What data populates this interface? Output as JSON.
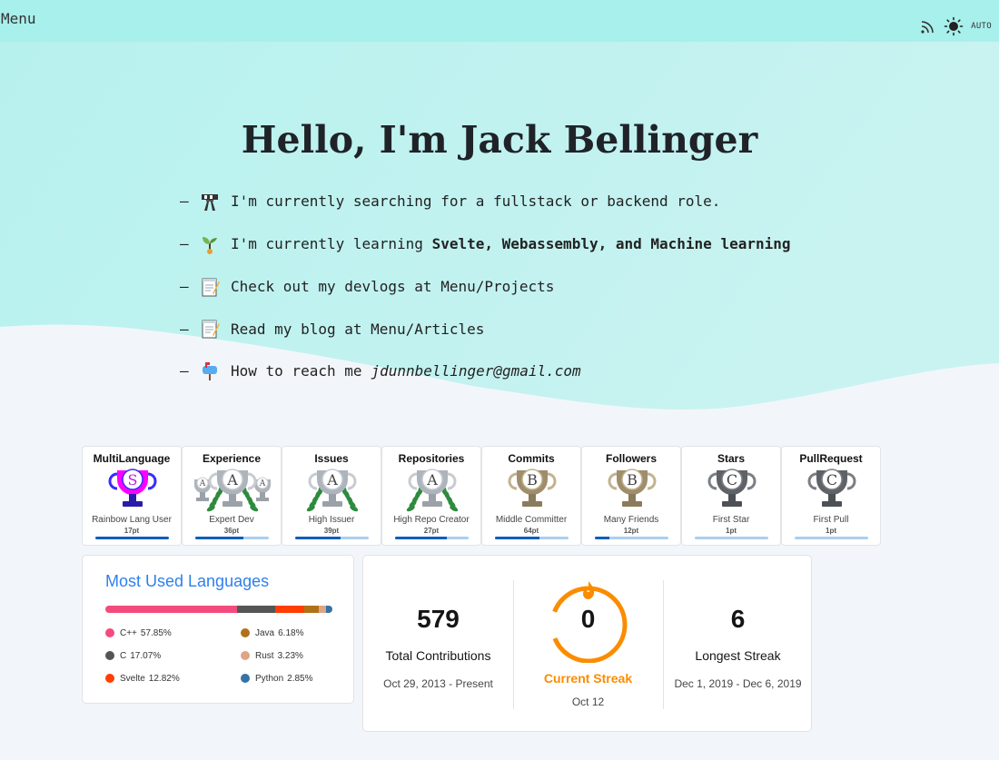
{
  "topbar": {
    "menu_label": "Menu",
    "rss_icon": "rss-icon",
    "theme_icon": "sun-icon",
    "theme_mode": "AUTO"
  },
  "hero": {
    "title": "Hello, I'm Jack Bellinger",
    "lines": [
      {
        "dash": "–",
        "icon": "construction-sign-icon",
        "text": "I'm currently searching for a fullstack or backend role."
      },
      {
        "dash": "–",
        "icon": "seedling-icon",
        "prefix": "I'm currently learning ",
        "bold": "Svelte, Webassembly, and Machine learning"
      },
      {
        "dash": "–",
        "icon": "memo-icon",
        "text": "Check out my devlogs at Menu/Projects"
      },
      {
        "dash": "–",
        "icon": "memo-icon",
        "text": "Read my blog at Menu/Articles"
      },
      {
        "dash": "–",
        "icon": "mailbox-icon",
        "prefix": "How to reach me",
        "email": "jdunnbellinger@gmail.com"
      }
    ]
  },
  "trophies": [
    {
      "category": "MultiLanguage",
      "rank": "S",
      "title": "Rainbow Lang User",
      "points": "17pt",
      "progress": 1.0
    },
    {
      "category": "Experience",
      "rank": "A",
      "title": "Expert Dev",
      "points": "36pt",
      "progress": 0.65
    },
    {
      "category": "Issues",
      "rank": "A",
      "title": "High Issuer",
      "points": "39pt",
      "progress": 0.62
    },
    {
      "category": "Repositories",
      "rank": "A",
      "title": "High Repo Creator",
      "points": "27pt",
      "progress": 0.7
    },
    {
      "category": "Commits",
      "rank": "B",
      "title": "Middle Committer",
      "points": "64pt",
      "progress": 0.6
    },
    {
      "category": "Followers",
      "rank": "B",
      "title": "Many Friends",
      "points": "12pt",
      "progress": 0.2
    },
    {
      "category": "Stars",
      "rank": "C",
      "title": "First Star",
      "points": "1pt",
      "progress": 0.0
    },
    {
      "category": "PullRequest",
      "rank": "C",
      "title": "First Pull",
      "points": "1pt",
      "progress": 0.0
    }
  ],
  "languages": {
    "title": "Most Used Languages",
    "items": [
      {
        "name": "C++",
        "percent": "57.85%",
        "value": 57.85,
        "color": "#f34b7d"
      },
      {
        "name": "C",
        "percent": "17.07%",
        "value": 17.07,
        "color": "#555555"
      },
      {
        "name": "Svelte",
        "percent": "12.82%",
        "value": 12.82,
        "color": "#ff3e00"
      },
      {
        "name": "Java",
        "percent": "6.18%",
        "value": 6.18,
        "color": "#b07219"
      },
      {
        "name": "Rust",
        "percent": "3.23%",
        "value": 3.23,
        "color": "#dea584"
      },
      {
        "name": "Python",
        "percent": "2.85%",
        "value": 2.85,
        "color": "#3572a5"
      }
    ]
  },
  "streak": {
    "total": "579",
    "total_label": "Total Contributions",
    "total_range": "Oct 29, 2013 - Present",
    "current": "0",
    "current_label": "Current Streak",
    "current_date": "Oct 12",
    "longest": "6",
    "longest_label": "Longest Streak",
    "longest_range": "Dec 1, 2019 - Dec 6, 2019"
  },
  "colors": {
    "accent": "#2f80ed",
    "streak_orange": "#fb8c00",
    "topbar": "#a7f0ec"
  }
}
